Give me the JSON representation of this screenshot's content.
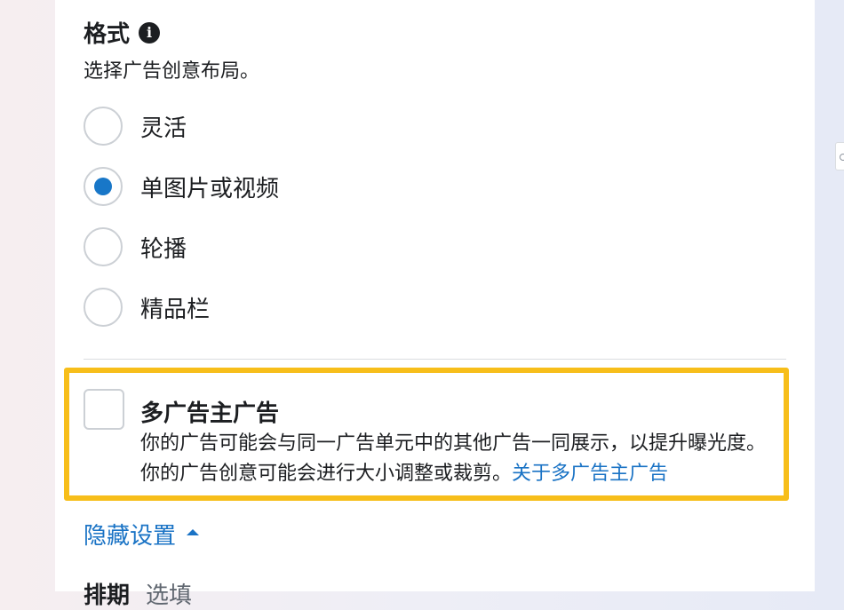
{
  "format": {
    "title": "格式",
    "info_icon": "info-icon",
    "subtitle": "选择广告创意布局。",
    "options": [
      {
        "label": "灵活",
        "selected": false
      },
      {
        "label": "单图片或视频",
        "selected": true
      },
      {
        "label": "轮播",
        "selected": false
      },
      {
        "label": "精品栏",
        "selected": false
      }
    ]
  },
  "multi_advertiser": {
    "checked": false,
    "title": "多广告主广告",
    "description": "你的广告可能会与同一广告单元中的其他广告一同展示，以提升曝光度。你的广告创意可能会进行大小调整或裁剪。",
    "link": "关于多广告主广告"
  },
  "hide_settings": {
    "label": "隐藏设置",
    "icon": "caret-up-icon"
  },
  "next_section": {
    "title": "排期",
    "optional": "选填"
  },
  "colors": {
    "accent": "#1877c8",
    "link": "#1a73c5",
    "highlight_border": "#f7be1a",
    "text": "#1c1e21"
  }
}
